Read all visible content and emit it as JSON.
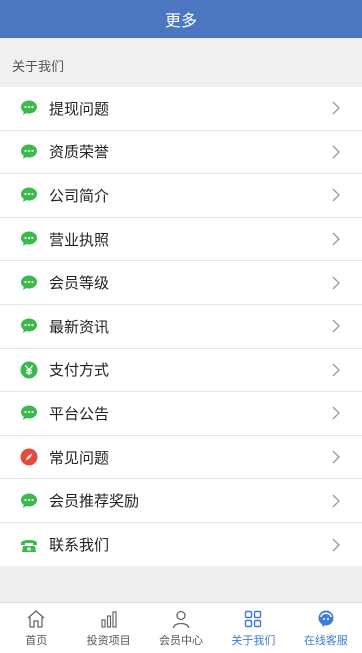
{
  "header": {
    "title": "更多"
  },
  "section": {
    "label": "关于我们"
  },
  "menu": {
    "items": [
      {
        "label": "提现问题",
        "icon": "chat-bubble-icon",
        "color": "#3bba4c"
      },
      {
        "label": "资质荣誉",
        "icon": "chat-bubble-icon",
        "color": "#3bba4c"
      },
      {
        "label": "公司简介",
        "icon": "chat-bubble-icon",
        "color": "#3bba4c"
      },
      {
        "label": "营业执照",
        "icon": "chat-bubble-icon",
        "color": "#3bba4c"
      },
      {
        "label": "会员等级",
        "icon": "chat-bubble-icon",
        "color": "#3bba4c"
      },
      {
        "label": "最新资讯",
        "icon": "chat-bubble-icon",
        "color": "#3bba4c"
      },
      {
        "label": "支付方式",
        "icon": "yen-coin-icon",
        "color": "#3bba4c"
      },
      {
        "label": "平台公告",
        "icon": "chat-bubble-icon",
        "color": "#3bba4c"
      },
      {
        "label": "常见问题",
        "icon": "compass-icon",
        "color": "#e24c3f"
      },
      {
        "label": "会员推荐奖励",
        "icon": "chat-bubble-icon",
        "color": "#3bba4c"
      },
      {
        "label": "联系我们",
        "icon": "phone-icon",
        "color": "#3bba4c"
      }
    ]
  },
  "tabbar": {
    "tabs": [
      {
        "label": "首页",
        "icon": "home-icon",
        "active": false
      },
      {
        "label": "投资项目",
        "icon": "bar-chart-icon",
        "active": false
      },
      {
        "label": "会员中心",
        "icon": "user-icon",
        "active": false
      },
      {
        "label": "关于我们",
        "icon": "grid-icon",
        "active": true
      },
      {
        "label": "在线客服",
        "icon": "service-icon",
        "active": true
      }
    ],
    "active_color": "#3d7bd8",
    "inactive_color": "#555555"
  }
}
